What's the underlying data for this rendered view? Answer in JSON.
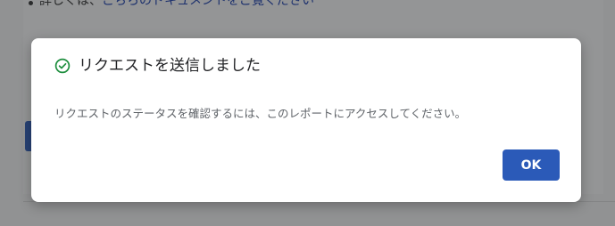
{
  "background": {
    "bullet_text_prefix": "詳しくは、",
    "bullet_link_text": "こちらのドキュメントをご覧ください"
  },
  "dialog": {
    "status_icon": "check-circle-icon",
    "title": "リクエストを送信しました",
    "message": "リクエストのステータスを確認するには、このレポートにアクセスしてください。",
    "ok_label": "OK",
    "colors": {
      "success": "#1e8e3e",
      "primary": "#2b5ab8"
    }
  }
}
